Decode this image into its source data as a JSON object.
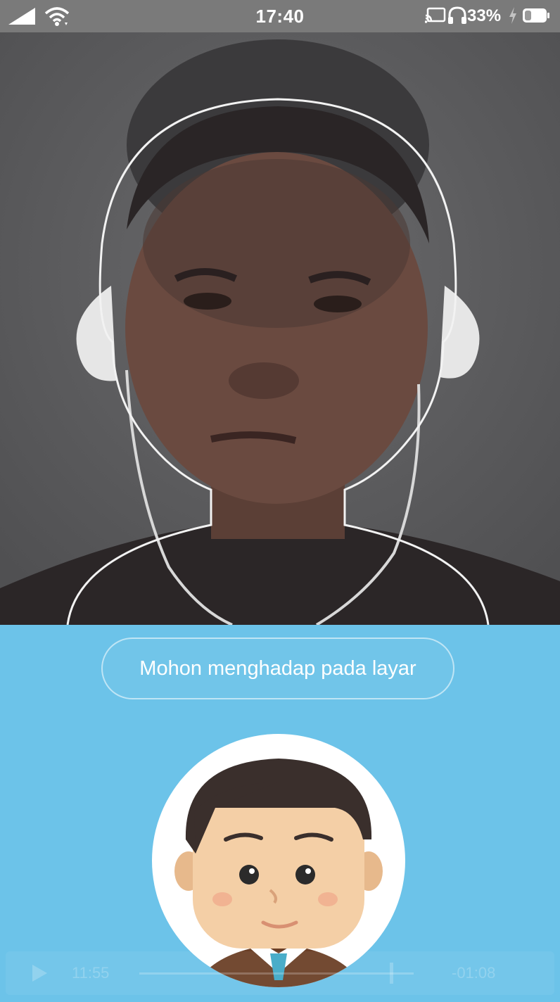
{
  "status_bar": {
    "time": "17:40",
    "battery_percent": "33%",
    "icons": [
      "signal-icon",
      "wifi-icon",
      "cast-icon",
      "headphones-icon",
      "charging-icon",
      "battery-icon"
    ]
  },
  "camera": {
    "description_icon": "face-outline-guide"
  },
  "instruction": {
    "text": "Mohon menghadap pada layar"
  },
  "avatar": {
    "icon": "cartoon-face-avatar"
  },
  "video_player": {
    "elapsed": "11:55",
    "remaining": "-01:08",
    "progress": 0.92,
    "icons": [
      "play-icon"
    ]
  },
  "colors": {
    "status_bar_bg": "#7a7a7a",
    "panel_bg": "#6cc3e9",
    "camera_bg": "#5f5f61",
    "pill_border": "#ffffff"
  }
}
